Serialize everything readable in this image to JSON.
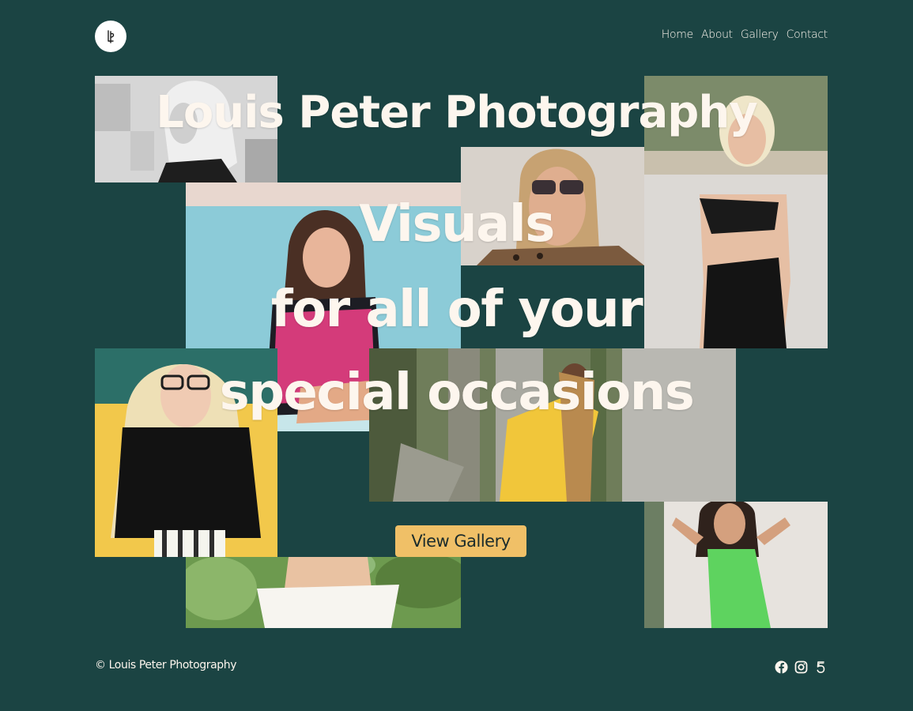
{
  "header": {
    "logo_icon": "lp-monogram-icon",
    "nav": [
      {
        "label": "Home"
      },
      {
        "label": "About"
      },
      {
        "label": "Gallery"
      },
      {
        "label": "Contact"
      }
    ]
  },
  "hero": {
    "title": "Louis Peter Photography",
    "tagline_lines": [
      "Visuals",
      "for all of your",
      "special occasions"
    ],
    "cta_label": "View Gallery"
  },
  "photos": [
    {
      "name": "photo-portrait-bw"
    },
    {
      "name": "photo-pool"
    },
    {
      "name": "photo-sunglasses"
    },
    {
      "name": "photo-beach-dress"
    },
    {
      "name": "photo-glasses-yellow"
    },
    {
      "name": "photo-forest-yellow"
    },
    {
      "name": "photo-white-top"
    },
    {
      "name": "photo-green-dress"
    }
  ],
  "footer": {
    "copyright": "© Louis Peter Photography",
    "socials": [
      {
        "icon": "facebook-icon"
      },
      {
        "icon": "instagram-icon"
      },
      {
        "icon": "500px-icon"
      }
    ]
  },
  "colors": {
    "background": "#1b4443",
    "text": "#fdf6ee",
    "accent": "#f0c067"
  }
}
